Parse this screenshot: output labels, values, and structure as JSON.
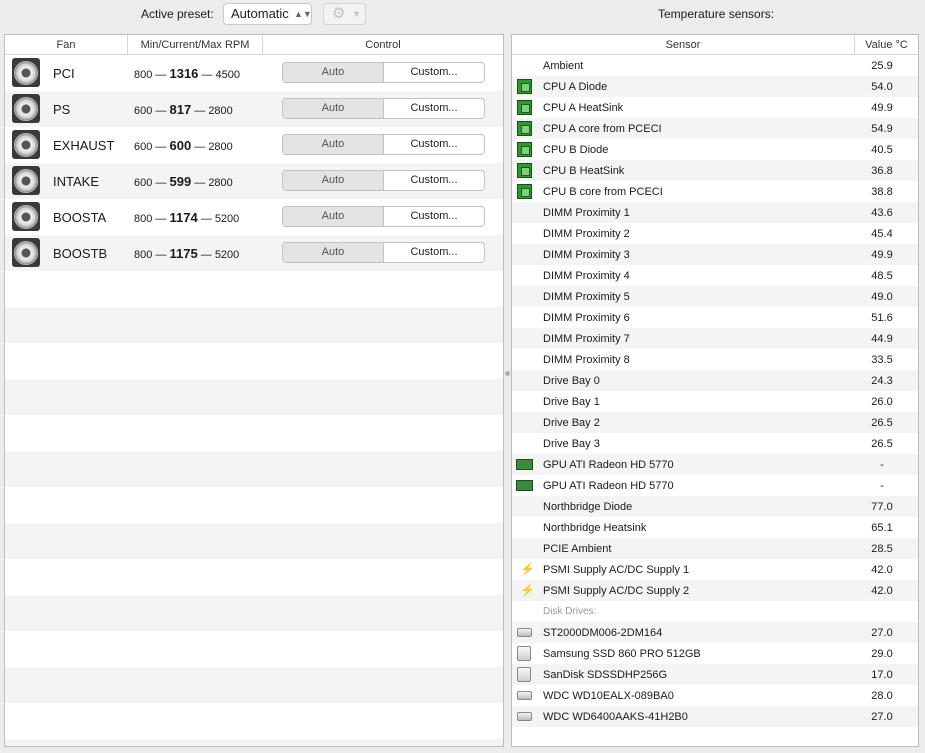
{
  "toolbar": {
    "active_preset_label": "Active preset:",
    "preset_value": "Automatic",
    "gear_icon": "gear-icon",
    "temp_sensors_label": "Temperature sensors:"
  },
  "fan_table": {
    "headers": [
      "Fan",
      "Min/Current/Max RPM",
      "Control"
    ],
    "rows": [
      {
        "name": "PCI",
        "min": "800",
        "current": "1316",
        "max": "4500",
        "auto": "Auto",
        "custom": "Custom..."
      },
      {
        "name": "PS",
        "min": "600",
        "current": "817",
        "max": "2800",
        "auto": "Auto",
        "custom": "Custom..."
      },
      {
        "name": "EXHAUST",
        "min": "600",
        "current": "600",
        "max": "2800",
        "auto": "Auto",
        "custom": "Custom..."
      },
      {
        "name": "INTAKE",
        "min": "600",
        "current": "599",
        "max": "2800",
        "auto": "Auto",
        "custom": "Custom..."
      },
      {
        "name": "BOOSTA",
        "min": "800",
        "current": "1174",
        "max": "5200",
        "auto": "Auto",
        "custom": "Custom..."
      },
      {
        "name": "BOOSTB",
        "min": "800",
        "current": "1175",
        "max": "5200",
        "auto": "Auto",
        "custom": "Custom..."
      }
    ]
  },
  "sensor_table": {
    "headers": [
      "Sensor",
      "Value °C"
    ],
    "rows": [
      {
        "icon": "none",
        "name": "Ambient",
        "value": "25.9"
      },
      {
        "icon": "cpu-chip-icon",
        "name": "CPU A Diode",
        "value": "54.0"
      },
      {
        "icon": "cpu-chip-icon",
        "name": "CPU A HeatSink",
        "value": "49.9"
      },
      {
        "icon": "cpu-chip-icon",
        "name": "CPU A core from PCECI",
        "value": "54.9"
      },
      {
        "icon": "cpu-chip-icon",
        "name": "CPU B Diode",
        "value": "40.5"
      },
      {
        "icon": "cpu-chip-icon",
        "name": "CPU B HeatSink",
        "value": "36.8"
      },
      {
        "icon": "cpu-chip-icon",
        "name": "CPU B core from PCECI",
        "value": "38.8"
      },
      {
        "icon": "none",
        "name": "DIMM Proximity 1",
        "value": "43.6"
      },
      {
        "icon": "none",
        "name": "DIMM Proximity 2",
        "value": "45.4"
      },
      {
        "icon": "none",
        "name": "DIMM Proximity 3",
        "value": "49.9"
      },
      {
        "icon": "none",
        "name": "DIMM Proximity 4",
        "value": "48.5"
      },
      {
        "icon": "none",
        "name": "DIMM Proximity 5",
        "value": "49.0"
      },
      {
        "icon": "none",
        "name": "DIMM Proximity 6",
        "value": "51.6"
      },
      {
        "icon": "none",
        "name": "DIMM Proximity 7",
        "value": "44.9"
      },
      {
        "icon": "none",
        "name": "DIMM Proximity 8",
        "value": "33.5"
      },
      {
        "icon": "none",
        "name": "Drive Bay 0",
        "value": "24.3"
      },
      {
        "icon": "none",
        "name": "Drive Bay 1",
        "value": "26.0"
      },
      {
        "icon": "none",
        "name": "Drive Bay 2",
        "value": "26.5"
      },
      {
        "icon": "none",
        "name": "Drive Bay 3",
        "value": "26.5"
      },
      {
        "icon": "gpu-card-icon",
        "name": "GPU ATI Radeon HD 5770",
        "value": "-"
      },
      {
        "icon": "gpu-card-icon",
        "name": "GPU ATI Radeon HD 5770",
        "value": "-"
      },
      {
        "icon": "none",
        "name": "Northbridge Diode",
        "value": "77.0"
      },
      {
        "icon": "none",
        "name": "Northbridge Heatsink",
        "value": "65.1"
      },
      {
        "icon": "none",
        "name": "PCIE Ambient",
        "value": "28.5"
      },
      {
        "icon": "power-bolt-icon",
        "name": "PSMI Supply AC/DC Supply 1",
        "value": "42.0"
      },
      {
        "icon": "power-bolt-icon",
        "name": "PSMI Supply AC/DC Supply 2",
        "value": "42.0"
      },
      {
        "icon": "section",
        "name": "Disk Drives:",
        "value": ""
      },
      {
        "icon": "hard-disk-icon",
        "name": "ST2000DM006-2DM164",
        "value": "27.0"
      },
      {
        "icon": "ssd-icon",
        "name": "Samsung SSD 860 PRO 512GB",
        "value": "29.0"
      },
      {
        "icon": "ssd-icon",
        "name": "SanDisk SDSSDHP256G",
        "value": "17.0"
      },
      {
        "icon": "hard-disk-icon",
        "name": "WDC WD10EALX-089BA0",
        "value": "28.0"
      },
      {
        "icon": "hard-disk-icon",
        "name": "WDC WD6400AAKS-41H2B0",
        "value": "27.0"
      }
    ]
  }
}
